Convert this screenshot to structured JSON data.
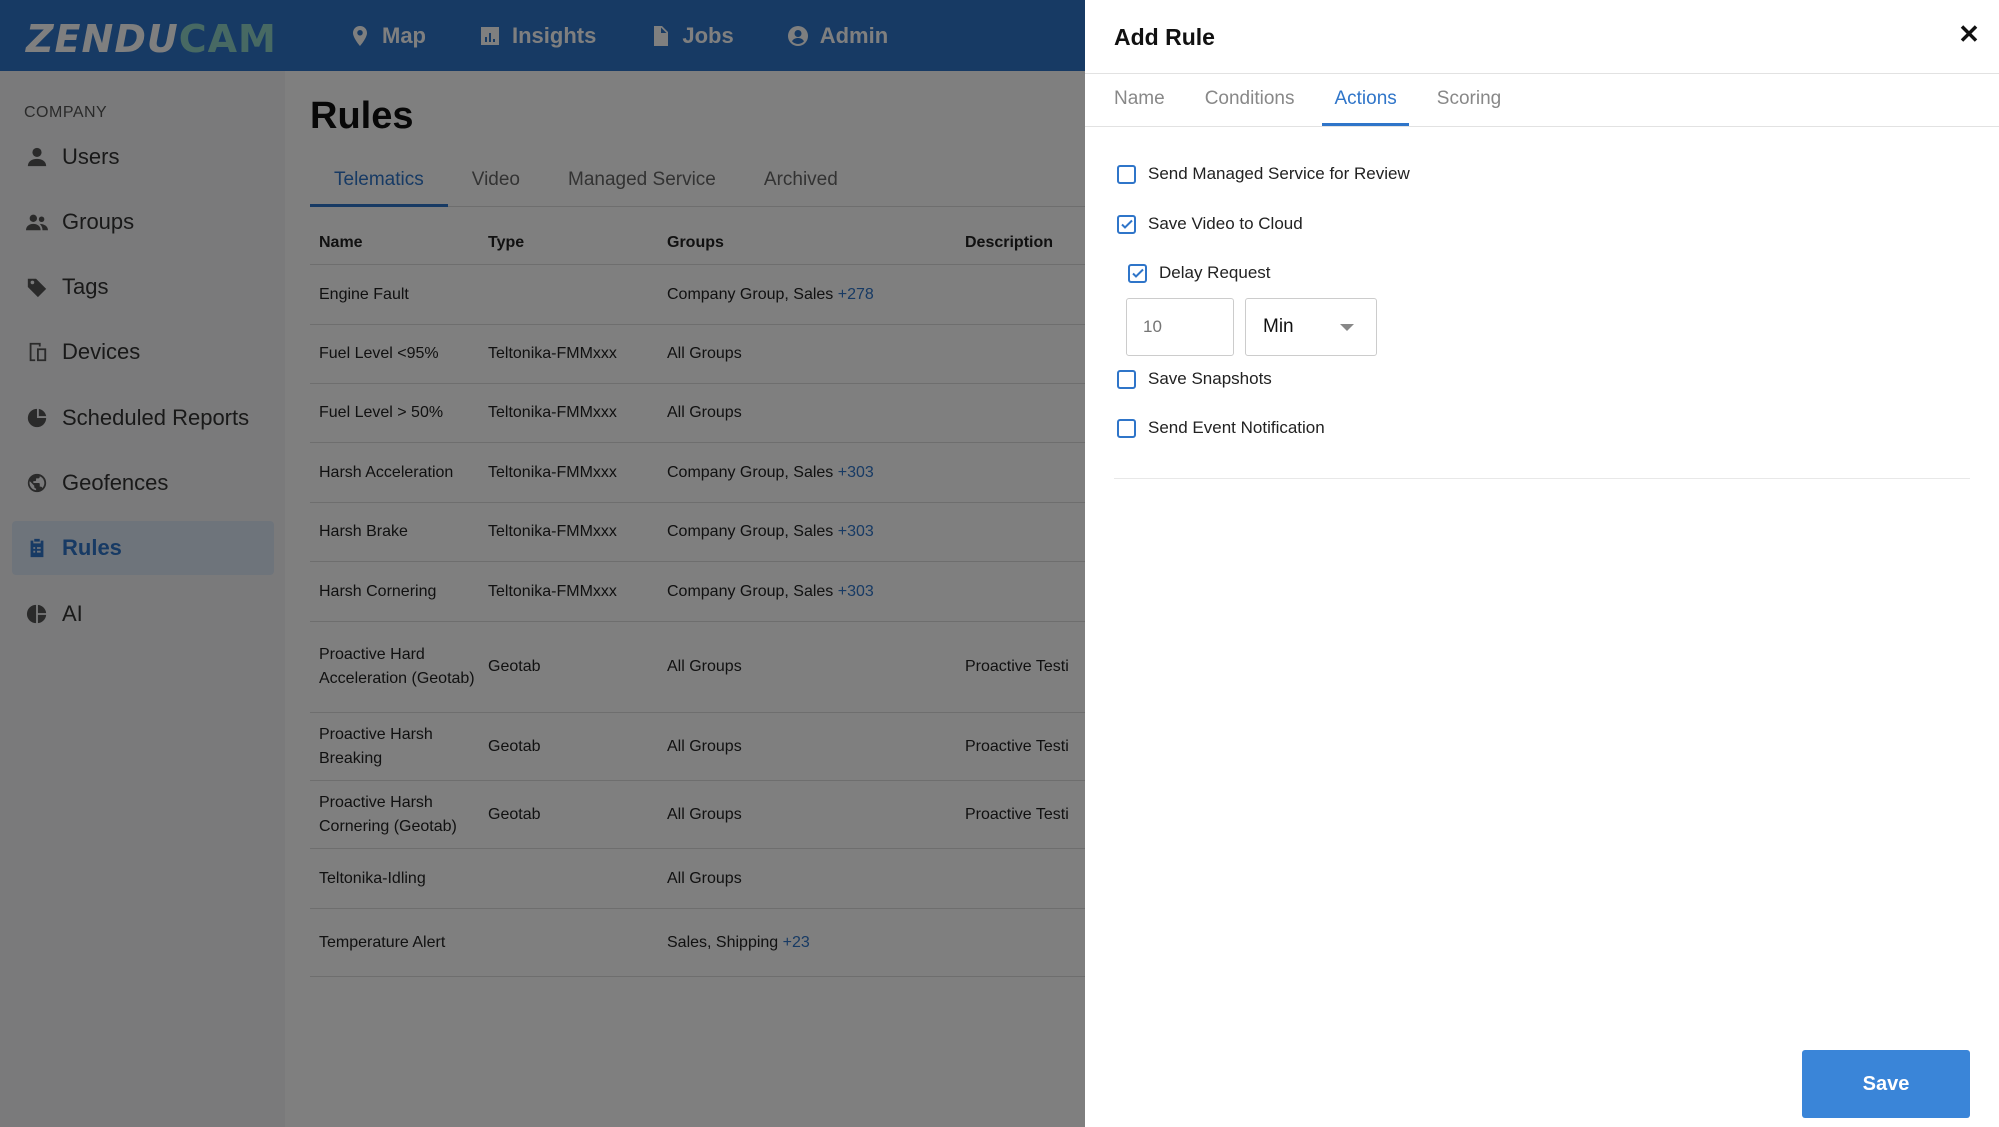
{
  "logo": {
    "part1": "ZENDU",
    "part2": "CAM"
  },
  "nav": [
    {
      "label": "Map",
      "icon": "map-pin-icon"
    },
    {
      "label": "Insights",
      "icon": "chart-icon"
    },
    {
      "label": "Jobs",
      "icon": "document-icon"
    },
    {
      "label": "Admin",
      "icon": "user-circle-icon"
    }
  ],
  "sidebar": {
    "section": "COMPANY",
    "items": [
      {
        "label": "Users",
        "icon": "user-icon"
      },
      {
        "label": "Groups",
        "icon": "group-icon"
      },
      {
        "label": "Tags",
        "icon": "tag-icon"
      },
      {
        "label": "Devices",
        "icon": "devices-icon"
      },
      {
        "label": "Scheduled Reports",
        "icon": "report-icon"
      },
      {
        "label": "Geofences",
        "icon": "globe-icon"
      },
      {
        "label": "Rules",
        "icon": "clipboard-icon",
        "active": true
      },
      {
        "label": "AI",
        "icon": "pie-icon"
      }
    ]
  },
  "main": {
    "title": "Rules",
    "tabs": [
      "Telematics",
      "Video",
      "Managed Service",
      "Archived"
    ],
    "columns": {
      "name": "Name",
      "type": "Type",
      "groups": "Groups",
      "description": "Description"
    },
    "rows": [
      {
        "name": "Engine Fault",
        "type": "",
        "groups": "Company Group, Sales",
        "more": "+278",
        "description": ""
      },
      {
        "name": "Fuel Level <95%",
        "type": "Teltonika-FMMxxx",
        "groups": "All Groups",
        "more": "",
        "description": ""
      },
      {
        "name": "Fuel Level > 50%",
        "type": "Teltonika-FMMxxx",
        "groups": "All Groups",
        "more": "",
        "description": ""
      },
      {
        "name": "Harsh Acceleration",
        "type": "Teltonika-FMMxxx",
        "groups": "Company Group, Sales",
        "more": "+303",
        "description": ""
      },
      {
        "name": "Harsh Brake",
        "type": "Teltonika-FMMxxx",
        "groups": "Company Group, Sales",
        "more": "+303",
        "description": ""
      },
      {
        "name": "Harsh Cornering",
        "type": "Teltonika-FMMxxx",
        "groups": "Company Group, Sales",
        "more": "+303",
        "description": ""
      },
      {
        "name": "Proactive Hard Acceleration (Geotab)",
        "type": "Geotab",
        "groups": "All Groups",
        "more": "",
        "description": "Proactive Testi"
      },
      {
        "name": "Proactive Harsh Breaking",
        "type": "Geotab",
        "groups": "All Groups",
        "more": "",
        "description": "Proactive Testi"
      },
      {
        "name": "Proactive Harsh Cornering (Geotab)",
        "type": "Geotab",
        "groups": "All Groups",
        "more": "",
        "description": "Proactive Testi"
      },
      {
        "name": "Teltonika-Idling",
        "type": "",
        "groups": "All Groups",
        "more": "",
        "description": ""
      },
      {
        "name": "Temperature Alert",
        "type": "",
        "groups": "Sales, Shipping",
        "more": "+23",
        "description": ""
      }
    ]
  },
  "drawer": {
    "title": "Add Rule",
    "close_icon": "close-icon",
    "tabs": [
      "Name",
      "Conditions",
      "Actions",
      "Scoring"
    ],
    "active_tab": "Actions",
    "actions": {
      "send_managed": {
        "label": "Send Managed Service for Review",
        "checked": false
      },
      "save_video": {
        "label": "Save Video to Cloud",
        "checked": true
      },
      "delay_request": {
        "label": "Delay Request",
        "checked": true
      },
      "delay_value_placeholder": "10",
      "delay_unit": "Min",
      "save_snapshots": {
        "label": "Save Snapshots",
        "checked": false
      },
      "send_notification": {
        "label": "Send Event Notification",
        "checked": false
      }
    },
    "save_label": "Save"
  },
  "colors": {
    "primary": "#2f75c9",
    "save": "#3a85d8",
    "logo_cam": "#8fd3c7"
  }
}
